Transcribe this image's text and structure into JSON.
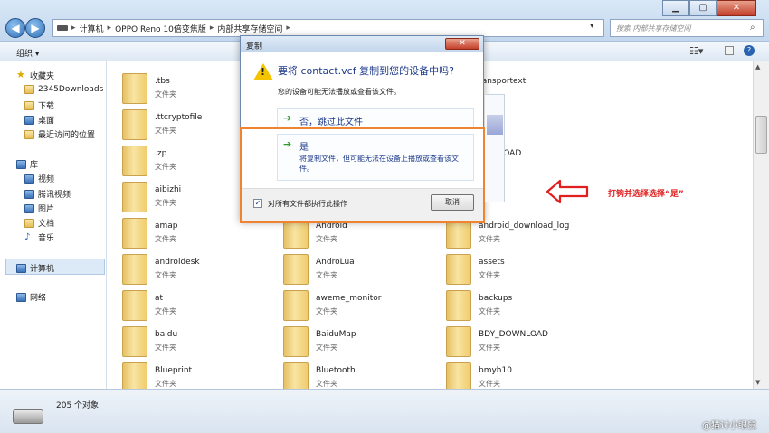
{
  "window": {
    "breadcrumb": [
      "计算机",
      "OPPO Reno 10倍变焦版",
      "内部共享存储空间"
    ],
    "search_placeholder": "搜索 内部共享存储空间",
    "min_label": "▁",
    "max_label": "▢",
    "close_label": "✕"
  },
  "toolbar": {
    "organize_label": "组织 ▾"
  },
  "sidebar": {
    "favorites_label": "收藏夹",
    "favorites_items": [
      "2345Downloads",
      "下载",
      "桌面",
      "最近访问的位置"
    ],
    "library_label": "库",
    "library_items": [
      "视频",
      "腾讯视频",
      "图片",
      "文档",
      "音乐"
    ],
    "computer_label": "计算机",
    "network_label": "网络"
  },
  "files": {
    "type_label": "文件夹",
    "col1": [
      ".tbs",
      ".ttcryptofile",
      ".zp",
      "aibizhi",
      "amap",
      "androidesk",
      "at",
      "baidu",
      "Blueprint"
    ],
    "col2": [
      "Android",
      "AndroLua",
      "aweme_monitor",
      "BaiduMap",
      "Bluetooth"
    ],
    "col3": [
      "android_download_log",
      "assets",
      "backups",
      "BDY_DOWNLOAD",
      "bmyh10"
    ],
    "partial": [
      "ransportext",
      "DWNLOAD"
    ]
  },
  "status": {
    "count": "205 个对象"
  },
  "watermark": "@猫讨小眼鼠",
  "dialog": {
    "title": "复制",
    "question": "要将 contact.vcf 复制到您的设备中吗?",
    "subtext": "您的设备可能无法播放或查看该文件。",
    "option_no": "否，跳过此文件",
    "option_yes": "是",
    "option_yes_desc": "将复制文件，但可能无法在设备上播放或查看该文件。",
    "checkbox_label": "对所有文件都执行此操作",
    "checkbox_checked": true,
    "cancel_label": "取消"
  },
  "annotation": {
    "text": "打钩并选择选择“是”",
    "color": "#e11f1f"
  }
}
